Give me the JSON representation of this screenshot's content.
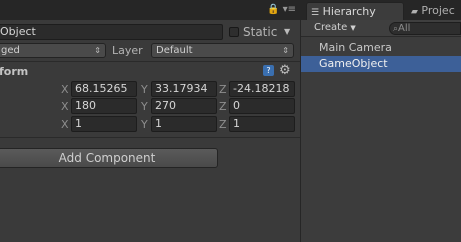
{
  "inspector": {
    "object_name": "Object",
    "static_label": "Static",
    "tag_value": "ged",
    "layer_label": "Layer",
    "layer_value": "Default",
    "component_title": "form",
    "transform": {
      "position": {
        "x": "68.15265",
        "y": "33.17934",
        "z": "-24.18218"
      },
      "rotation": {
        "x": "180",
        "y": "270",
        "z": "0"
      },
      "scale": {
        "x": "1",
        "y": "1",
        "z": "1"
      }
    },
    "axis_labels": {
      "x": "X",
      "y": "Y",
      "z": "Z"
    },
    "add_component_label": "Add Component"
  },
  "hierarchy": {
    "tab_label": "Hierarchy",
    "project_tab_label": "Projec",
    "create_label": "Create",
    "search_placeholder": "All",
    "items": [
      {
        "label": "Main Camera",
        "selected": false
      },
      {
        "label": "GameObject",
        "selected": true
      }
    ]
  },
  "colors": {
    "selection": "#3d6098",
    "background": "#383838"
  }
}
